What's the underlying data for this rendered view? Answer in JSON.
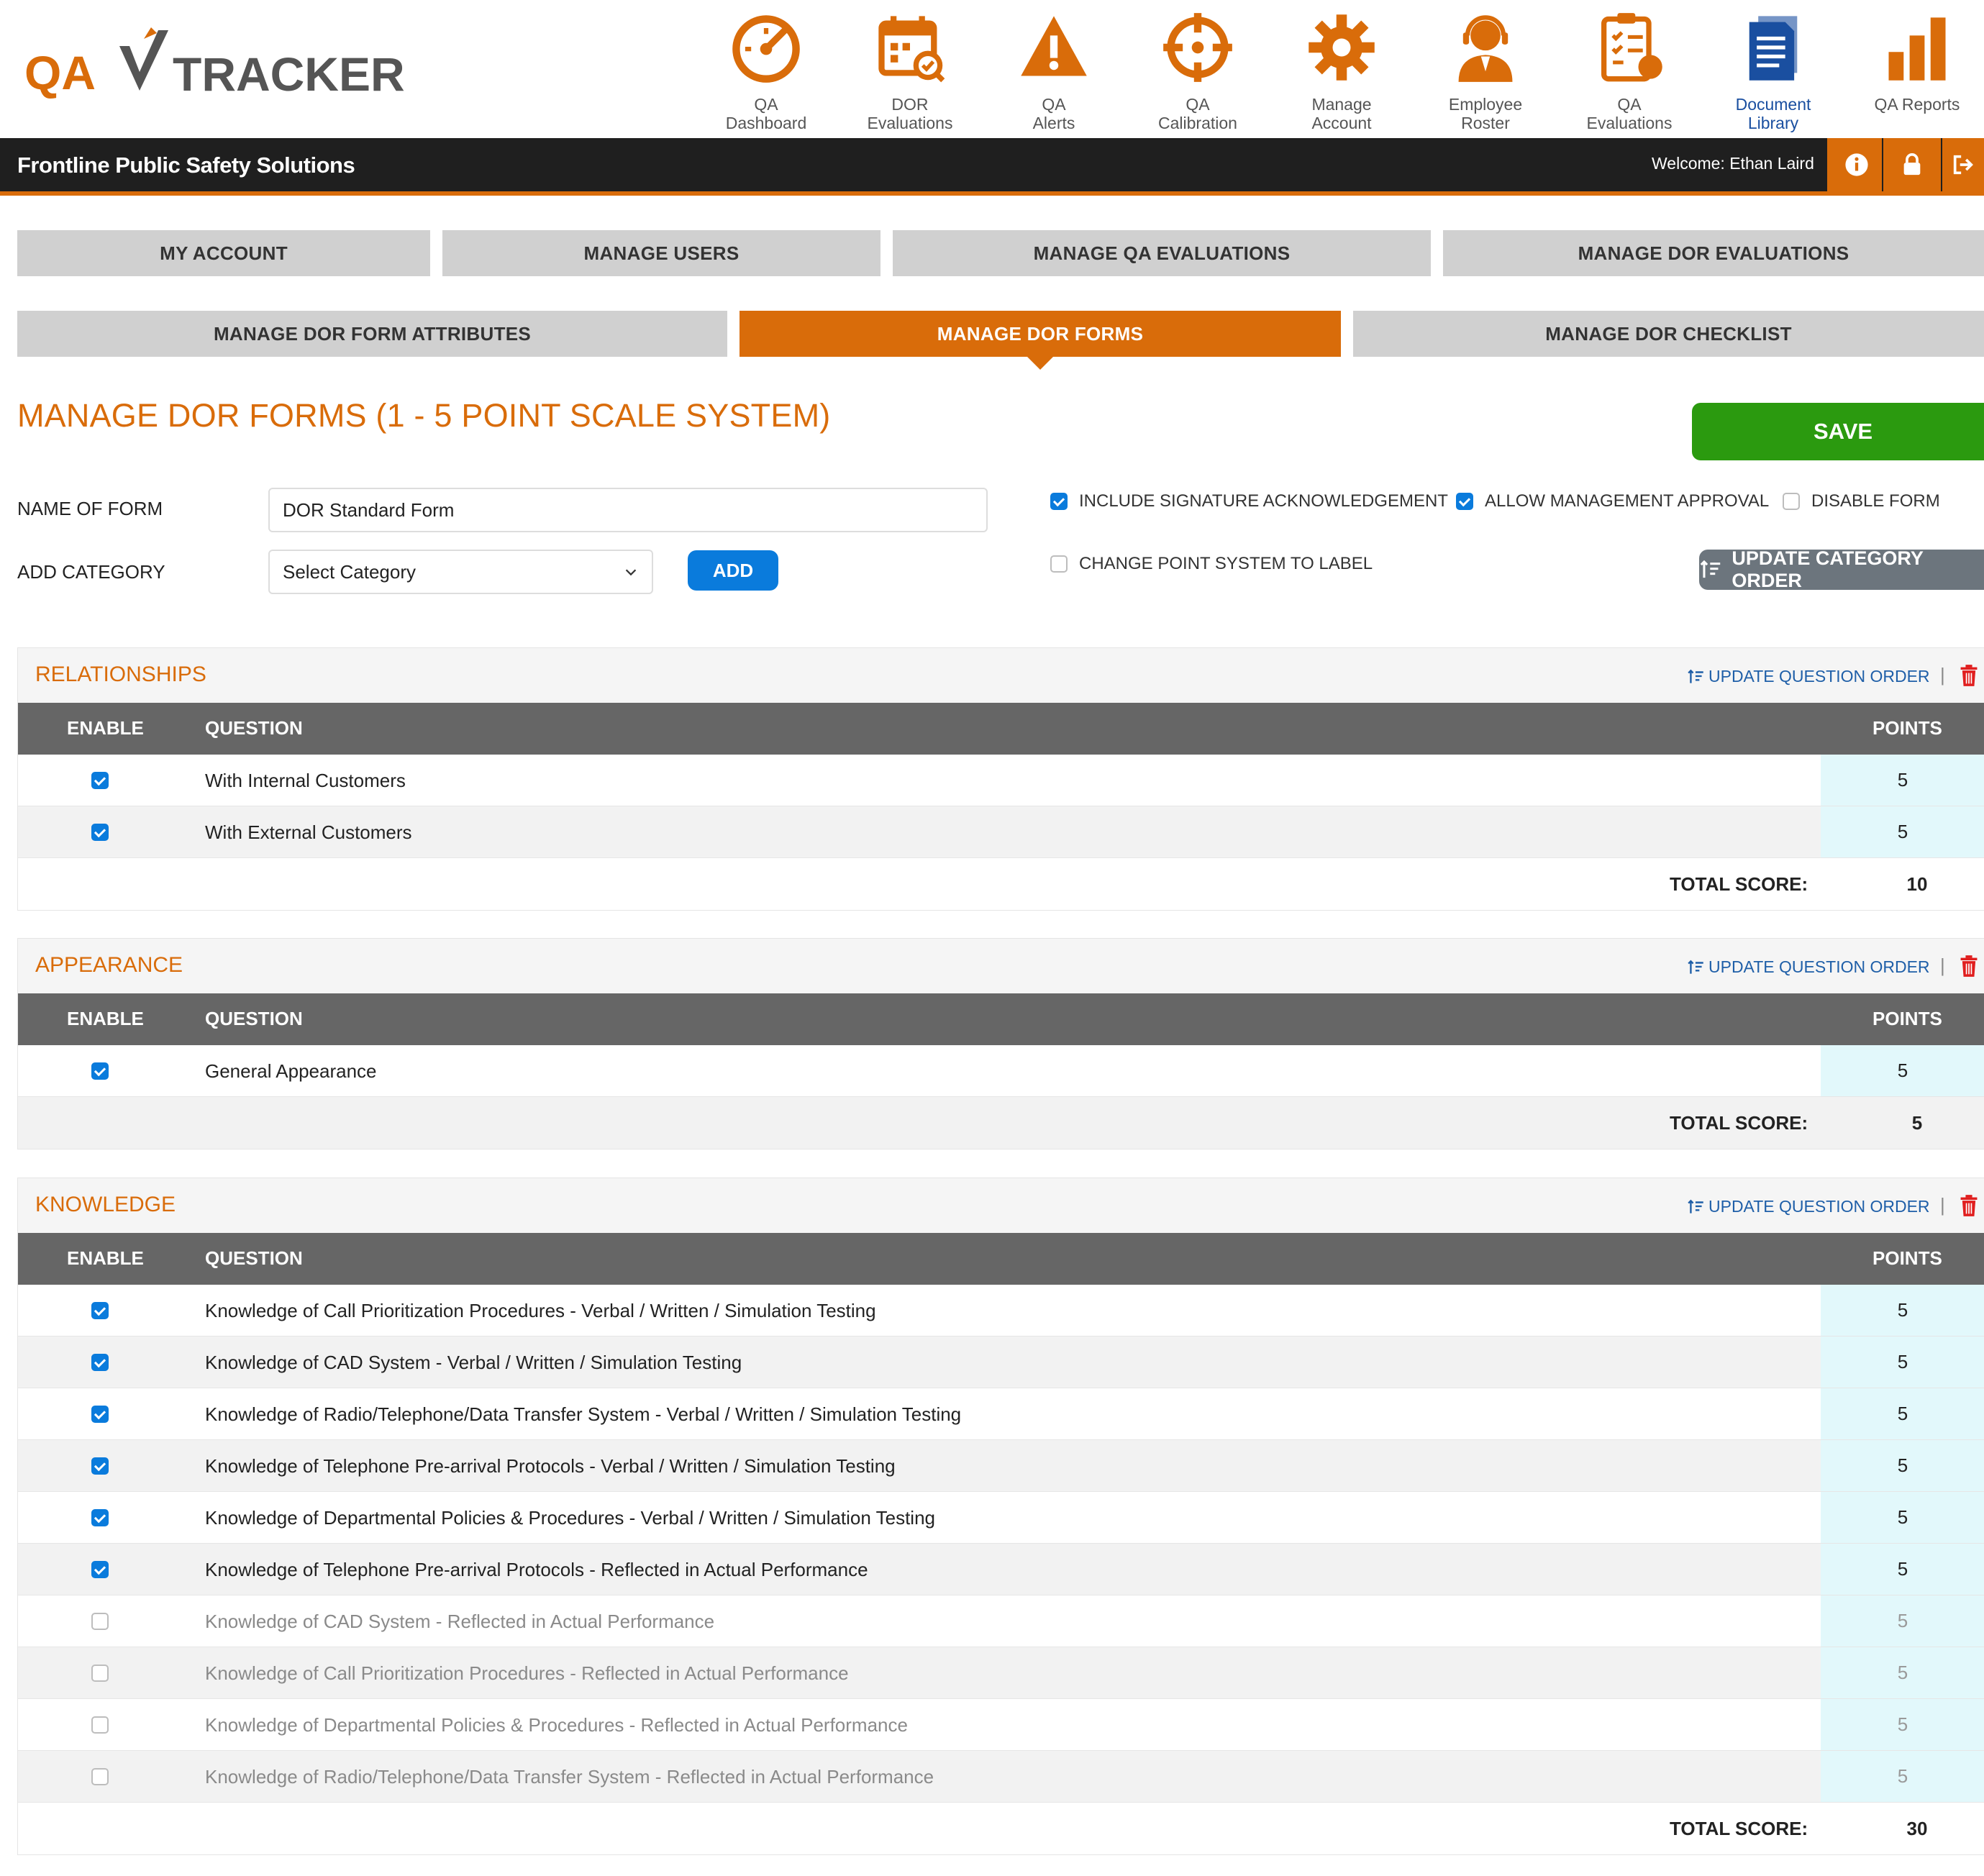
{
  "app": {
    "logo_text": "QA TRACKER"
  },
  "nav": [
    {
      "label1": "QA",
      "label2": "Dashboard",
      "icon": "gauge-icon",
      "active": false
    },
    {
      "label1": "DOR",
      "label2": "Evaluations",
      "icon": "calendar-check-icon",
      "active": false
    },
    {
      "label1": "QA",
      "label2": "Alerts",
      "icon": "alert-icon",
      "active": false
    },
    {
      "label1": "QA",
      "label2": "Calibration",
      "icon": "crosshair-icon",
      "active": false
    },
    {
      "label1": "Manage",
      "label2": "Account",
      "icon": "gear-icon",
      "active": false
    },
    {
      "label1": "Employee",
      "label2": "Roster",
      "icon": "headset-user-icon",
      "active": false
    },
    {
      "label1": "QA",
      "label2": "Evaluations",
      "icon": "clipboard-icon",
      "active": false
    },
    {
      "label1": "Document",
      "label2": "Library",
      "icon": "documents-icon",
      "active": true
    },
    {
      "label1": "QA Reports",
      "label2": "",
      "icon": "bar-chart-icon",
      "active": false
    }
  ],
  "bar": {
    "company": "Frontline Public Safety Solutions",
    "welcome": "Welcome: Ethan Laird"
  },
  "tabs_row1": [
    "MY ACCOUNT",
    "MANAGE USERS",
    "MANAGE QA EVALUATIONS",
    "MANAGE DOR EVALUATIONS"
  ],
  "tabs_row2": [
    "MANAGE DOR FORM ATTRIBUTES",
    "MANAGE DOR FORMS",
    "MANAGE DOR CHECKLIST"
  ],
  "page": {
    "heading": "MANAGE DOR FORMS (1 - 5 POINT SCALE SYSTEM)",
    "save": "SAVE",
    "name_label": "NAME OF FORM",
    "name_value": "DOR Standard Form",
    "category_label": "ADD CATEGORY",
    "category_select": "Select Category",
    "add": "ADD",
    "opt_signature": "INCLUDE SIGNATURE ACKNOWLEDGEMENT",
    "opt_approval": "ALLOW MANAGEMENT APPROVAL",
    "opt_disable": "DISABLE FORM",
    "opt_label": "CHANGE POINT SYSTEM TO LABEL",
    "update_category_order": "UPDATE CATEGORY ORDER"
  },
  "table_headers": {
    "enable": "ENABLE",
    "question": "QUESTION",
    "points": "POINTS",
    "total": "TOTAL SCORE:",
    "update_order": "UPDATE QUESTION ORDER"
  },
  "sections": [
    {
      "title": "RELATIONSHIPS",
      "total": "10",
      "rows": [
        {
          "q": "With Internal Customers",
          "pts": "5",
          "on": true
        },
        {
          "q": "With External Customers",
          "pts": "5",
          "on": true
        }
      ]
    },
    {
      "title": "APPEARANCE",
      "total": "5",
      "rows": [
        {
          "q": "General Appearance",
          "pts": "5",
          "on": true
        }
      ]
    },
    {
      "title": "KNOWLEDGE",
      "total": "30",
      "rows": [
        {
          "q": "Knowledge of Call Prioritization Procedures - Verbal / Written / Simulation Testing",
          "pts": "5",
          "on": true
        },
        {
          "q": "Knowledge of CAD System - Verbal / Written / Simulation Testing",
          "pts": "5",
          "on": true
        },
        {
          "q": "Knowledge of Radio/Telephone/Data Transfer System - Verbal / Written / Simulation Testing",
          "pts": "5",
          "on": true
        },
        {
          "q": "Knowledge of Telephone Pre-arrival Protocols - Verbal / Written / Simulation Testing",
          "pts": "5",
          "on": true
        },
        {
          "q": "Knowledge of Departmental Policies & Procedures - Verbal / Written / Simulation Testing",
          "pts": "5",
          "on": true
        },
        {
          "q": "Knowledge of Telephone Pre-arrival Protocols - Reflected in Actual Performance",
          "pts": "5",
          "on": true
        },
        {
          "q": "Knowledge of CAD System - Reflected in Actual Performance",
          "pts": "5",
          "on": false
        },
        {
          "q": "Knowledge of Call Prioritization Procedures - Reflected in Actual Performance",
          "pts": "5",
          "on": false
        },
        {
          "q": "Knowledge of Departmental Policies & Procedures - Reflected in Actual Performance",
          "pts": "5",
          "on": false
        },
        {
          "q": "Knowledge of Radio/Telephone/Data Transfer System - Reflected in Actual Performance",
          "pts": "5",
          "on": false
        }
      ]
    }
  ],
  "colors": {
    "accent": "#d96c0a",
    "save": "#2b9a0f",
    "blue": "#0a7bdc",
    "header_gray": "#666666",
    "points_bg": "#e2f8fb"
  }
}
